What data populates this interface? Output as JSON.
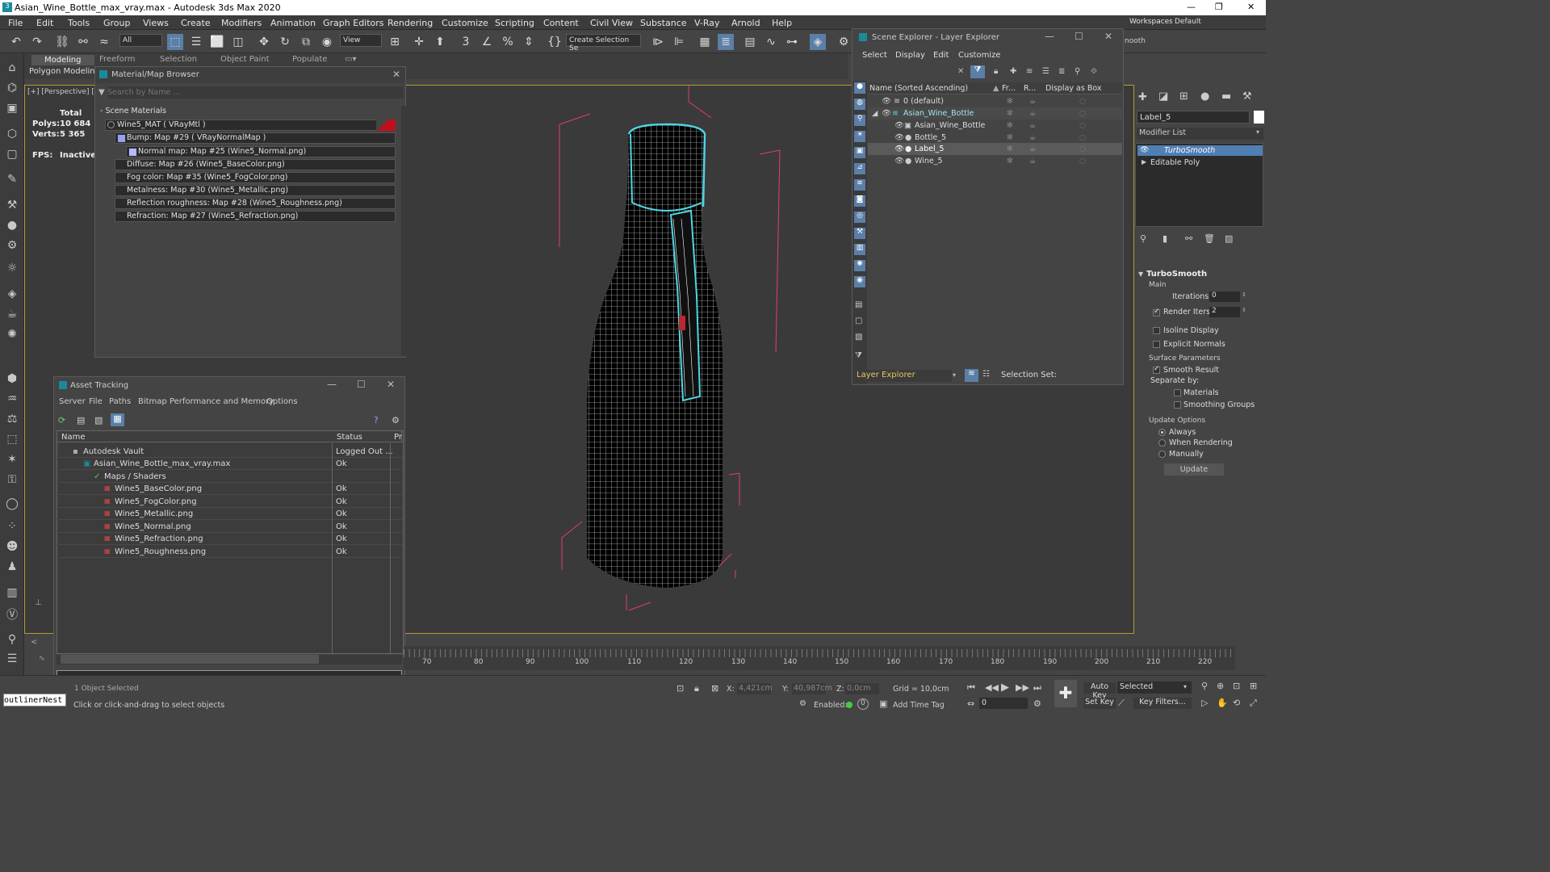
{
  "title": "Asian_Wine_Bottle_max_vray.max - Autodesk 3ds Max 2020",
  "menu": [
    "File",
    "Edit",
    "Tools",
    "Group",
    "Views",
    "Create",
    "Modifiers",
    "Animation",
    "Graph Editors",
    "Rendering",
    "Customize",
    "Scripting",
    "Content",
    "Civil View",
    "Substance",
    "V-Ray",
    "Arnold",
    "Help"
  ],
  "workspaces_label": "Workspaces:",
  "workspaces_value": "Default",
  "toolbar": {
    "selection_filter": "All",
    "ref_coord": "View",
    "named_selection": "Create Selection Se",
    "right_text": "nooth"
  },
  "ribbon": {
    "tabs": [
      "Modeling",
      "Freeform",
      "Selection",
      "Object Paint",
      "Populate"
    ],
    "sub": "Polygon Modelin"
  },
  "viewport": {
    "label": "[+] [Perspective] [S",
    "stats": {
      "total": "Total",
      "polys_label": "Polys:",
      "polys": "10 684",
      "verts_label": "Verts:",
      "verts": "5 365",
      "fps_label": "FPS:",
      "fps": "Inactive"
    }
  },
  "mat_browser": {
    "title": "Material/Map Browser",
    "search_placeholder": "Search by Name ...",
    "section": "- Scene Materials",
    "items": [
      "Wine5_MAT  ( VRayMtl )",
      "Bump: Map #29  ( VRayNormalMap )",
      "Normal map: Map #25 (Wine5_Normal.png)",
      "Diffuse: Map #26 (Wine5_BaseColor.png)",
      "Fog color: Map #35 (Wine5_FogColor.png)",
      "Metalness: Map #30 (Wine5_Metallic.png)",
      "Reflection roughness: Map #28 (Wine5_Roughness.png)",
      "Refraction: Map #27 (Wine5_Refraction.png)"
    ]
  },
  "asset_tracking": {
    "title": "Asset Tracking",
    "menu": [
      "Server",
      "File",
      "Paths",
      "Bitmap Performance and Memory",
      "Options"
    ],
    "columns": [
      "Name",
      "Status",
      "Pr"
    ],
    "rows": [
      {
        "name": "Autodesk Vault",
        "status": "Logged Out ..."
      },
      {
        "name": "Asian_Wine_Bottle_max_vray.max",
        "status": "Ok"
      },
      {
        "name": "Maps / Shaders",
        "status": ""
      },
      {
        "name": "Wine5_BaseColor.png",
        "status": "Ok"
      },
      {
        "name": "Wine5_FogColor.png",
        "status": "Ok"
      },
      {
        "name": "Wine5_Metallic.png",
        "status": "Ok"
      },
      {
        "name": "Wine5_Normal.png",
        "status": "Ok"
      },
      {
        "name": "Wine5_Refraction.png",
        "status": "Ok"
      },
      {
        "name": "Wine5_Roughness.png",
        "status": "Ok"
      }
    ]
  },
  "scene_explorer": {
    "title": "Scene Explorer - Layer Explorer",
    "menu": [
      "Select",
      "Display",
      "Edit",
      "Customize"
    ],
    "columns": [
      "Name (Sorted Ascending)",
      "Fr...",
      "R...",
      "Display as Box"
    ],
    "rows": [
      "0 (default)",
      "Asian_Wine_Bottle",
      "Asian_Wine_Bottle",
      "Bottle_5",
      "Label_5",
      "Wine_5"
    ],
    "footer_mode": "Layer Explorer",
    "selection_set": "Selection Set:"
  },
  "cmd_panel": {
    "object_name": "Label_5",
    "modifier_list": "Modifier List",
    "stack": [
      "TurboSmooth",
      "Editable Poly"
    ],
    "rollout": "TurboSmooth",
    "main": "Main",
    "iterations_label": "Iterations:",
    "iterations": "0",
    "render_iters_label": "Render Iters:",
    "render_iters": "2",
    "isoline": "Isoline Display",
    "explicit": "Explicit Normals",
    "surface": "Surface Parameters",
    "smooth_result": "Smooth Result",
    "separate_by": "Separate by:",
    "materials": "Materials",
    "smoothing_groups": "Smoothing Groups",
    "update_options": "Update Options",
    "always": "Always",
    "when_rendering": "When Rendering",
    "manually": "Manually",
    "update_btn": "Update"
  },
  "timeline": {
    "ticks": [
      "70",
      "80",
      "90",
      "100",
      "110",
      "120",
      "130",
      "140",
      "150",
      "160",
      "170",
      "180",
      "190",
      "200",
      "210",
      "220"
    ]
  },
  "status": {
    "script_field": "outlinerNest",
    "selected": "1 Object Selected",
    "prompt": "Click or click-and-drag to select objects",
    "x_label": "X:",
    "x": "4,421cm",
    "y_label": "Y:",
    "y": "40,987cm",
    "z_label": "Z:",
    "z": "0,0cm",
    "grid": "Grid = 10,0cm",
    "enabled": "Enabled:",
    "add_time_tag": "Add Time Tag",
    "frame": "0",
    "auto_key": "Auto Key",
    "selected_dd": "Selected",
    "set_key": "Set Key",
    "key_filters": "Key Filters..."
  }
}
